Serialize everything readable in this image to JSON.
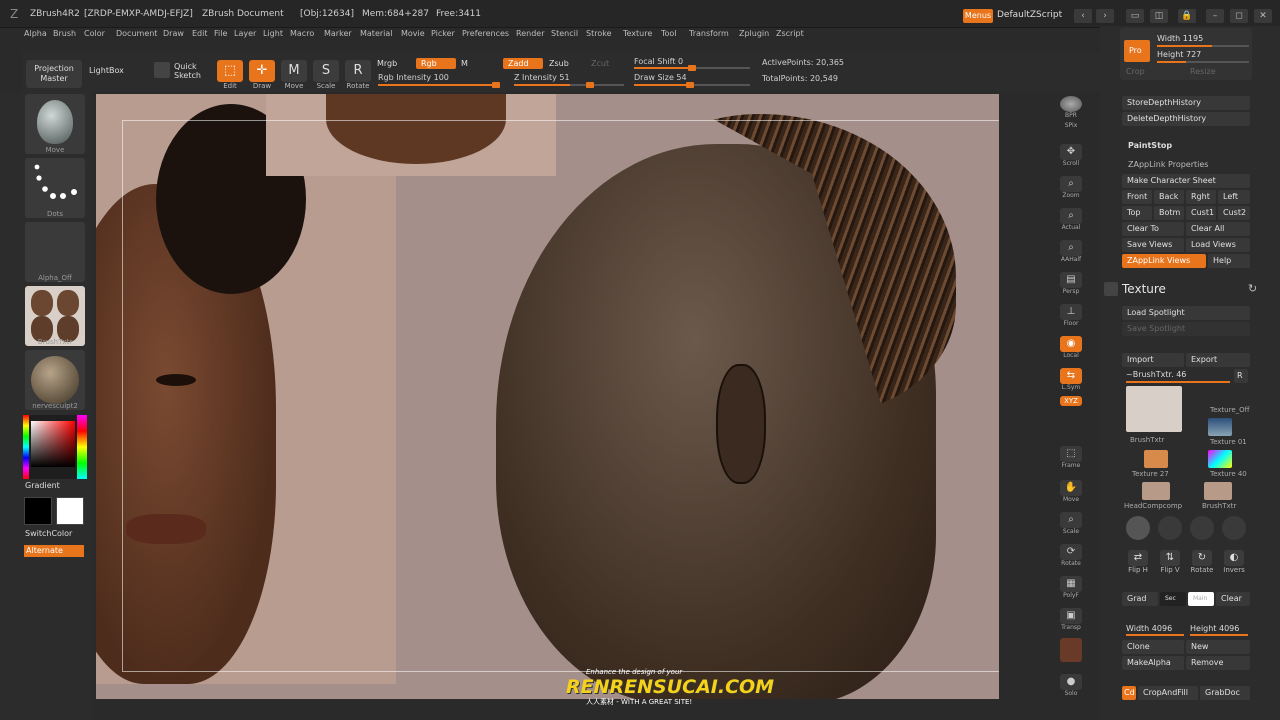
{
  "window": {
    "app_title": "ZBrush4R2",
    "session_id": "[ZRDP-EMXP-AMDJ-EFJZ]",
    "document": "ZBrush Document",
    "obj_info": "[Obj:12634]",
    "mem_info": "Mem:684+287",
    "free_info": "Free:3411",
    "menus_button": "Menus",
    "default_script": "DefaultZScript"
  },
  "menu": [
    "Alpha",
    "Brush",
    "Color",
    "Document",
    "Draw",
    "Edit",
    "File",
    "Layer",
    "Light",
    "Macro",
    "Marker",
    "Material",
    "Movie",
    "Picker",
    "Preferences",
    "Render",
    "Stencil",
    "Stroke",
    "Texture",
    "Tool",
    "Transform",
    "Zplugin",
    "Zscript"
  ],
  "shelf": {
    "projection_master": "Projection Master",
    "lightbox": "LightBox",
    "quick_sketch": "Quick Sketch",
    "edit": "Edit",
    "draw": "Draw",
    "move": "Move",
    "scale": "Scale",
    "rotate": "Rotate",
    "mrgb": "Mrgb",
    "rgb": "Rgb",
    "m": "M",
    "rgb_intensity_label": "Rgb Intensity",
    "rgb_intensity": 100,
    "zadd": "Zadd",
    "zsub": "Zsub",
    "zcut": "Zcut",
    "z_intensity_label": "Z Intensity",
    "z_intensity": 51,
    "focal_shift_label": "Focal Shift",
    "focal_shift": 0,
    "draw_size_label": "Draw Size",
    "draw_size": 54,
    "active_points_label": "ActivePoints:",
    "active_points": "20,365",
    "total_points_label": "TotalPoints:",
    "total_points": "20,549"
  },
  "left_tray": {
    "brush_label": "Move",
    "stroke_label": "Dots",
    "alpha_label": "Alpha_Off",
    "texture_label": "BrushTxtr",
    "material_label": "nervesculpt2",
    "gradient": "Gradient",
    "switch_color": "SwitchColor",
    "alternate": "Alternate"
  },
  "vstrip": [
    {
      "name": "bpr",
      "label": "BPR"
    },
    {
      "name": "spix",
      "label": "SPix"
    },
    {
      "name": "scroll",
      "label": "Scroll"
    },
    {
      "name": "zoom",
      "label": "Zoom"
    },
    {
      "name": "actual",
      "label": "Actual"
    },
    {
      "name": "aahalf",
      "label": "AAHalf"
    },
    {
      "name": "persp",
      "label": "Persp"
    },
    {
      "name": "floor",
      "label": "Floor"
    },
    {
      "name": "local",
      "label": "Local"
    },
    {
      "name": "lsym",
      "label": "L.Sym"
    },
    {
      "name": "xyz",
      "label": "XYZ"
    },
    {
      "name": "frame",
      "label": "Frame"
    },
    {
      "name": "move",
      "label": "Move"
    },
    {
      "name": "scale",
      "label": "Scale"
    },
    {
      "name": "rotate",
      "label": "Rotate"
    },
    {
      "name": "polyf",
      "label": "PolyF"
    },
    {
      "name": "transp",
      "label": "Transp"
    },
    {
      "name": "solo",
      "label": "Solo"
    }
  ],
  "palette": {
    "pro": "Pro",
    "width_label": "Width",
    "width": 1195,
    "height_label": "Height",
    "height": 727,
    "crop": "Crop",
    "resize": "Resize",
    "store_depth": "StoreDepthHistory",
    "delete_depth": "DeleteDepthHistory",
    "paintstop": "PaintStop",
    "zapplink_props": "ZAppLink Properties",
    "make_char_sheet": "Make Character Sheet",
    "front": "Front",
    "back": "Back",
    "rght": "Rght",
    "left": "Left",
    "top": "Top",
    "botm": "Botm",
    "cust1": "Cust1",
    "cust2": "Cust2",
    "clear_to": "Clear To",
    "clear_all": "Clear All",
    "save_views": "Save Views",
    "load_views": "Load Views",
    "zapplink_views": "ZAppLink Views",
    "help": "Help",
    "texture_title": "Texture",
    "load_spotlight": "Load Spotlight",
    "save_spotlight": "Save Spotlight",
    "import": "Import",
    "export": "Export",
    "brushtxtr_label": "~BrushTxtr. 46",
    "r": "R",
    "textures": [
      {
        "name": "BrushTxtr"
      },
      {
        "name": "Texture_Off"
      },
      {
        "name": "Texture 01"
      },
      {
        "name": "Texture 27"
      },
      {
        "name": "Texture 40"
      },
      {
        "name": "HeadCompcomp"
      },
      {
        "name": "BrushTxtr"
      }
    ],
    "flip_h": "Flip H",
    "flip_v": "Flip V",
    "rotate": "Rotate",
    "invers": "Invers",
    "grad": "Grad",
    "sec": "Sec",
    "main": "Main",
    "clear": "Clear",
    "tex_width_label": "Width",
    "tex_width": 4096,
    "tex_height_label": "Height",
    "tex_height": 4096,
    "clone": "Clone",
    "new": "New",
    "makealpha": "MakeAlpha",
    "remove": "Remove",
    "cd": "Cd",
    "crop_and_fill": "CropAndFill",
    "grabdoc": "GrabDoc"
  },
  "watermark": {
    "line1": "Enhance the design of your",
    "line2": "RENRENSUCAI.COM",
    "line3": "人人素材 - WITH A GREAT SITE!"
  },
  "colors": {
    "accent": "#e8741c",
    "bg": "#2a2a2a",
    "canvas": "#a58f8b"
  }
}
